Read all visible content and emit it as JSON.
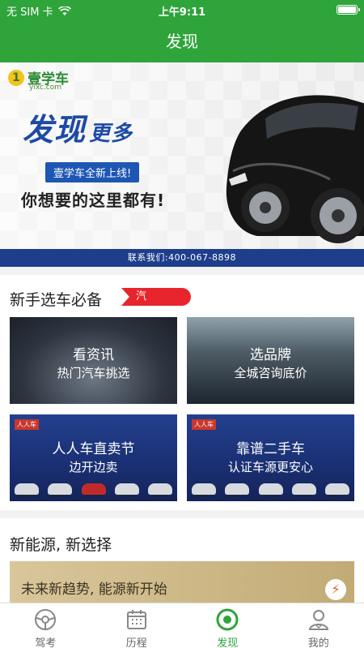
{
  "status_bar": {
    "carrier": "无 SIM 卡",
    "time": "上午9:11"
  },
  "header": {
    "title": "发现"
  },
  "banner": {
    "logo_name": "壹学车",
    "logo_url_text": "yixc.com",
    "headline_main": "发现",
    "headline_small": "更多",
    "pill_text": "壹学车全新上线!",
    "slogan": "你想要的这里都有!",
    "contact": "联系我们:400-067-8898"
  },
  "section_new_driver": {
    "title": "新手选车必备",
    "tag": "汽",
    "cards": [
      {
        "line1": "看资讯",
        "line2": "热门汽车挑选"
      },
      {
        "line1": "选品牌",
        "line2": "全城咨询底价"
      },
      {
        "line1": "人人车直卖节",
        "line2": "边开边卖",
        "logo": "人人车"
      },
      {
        "line1": "靠谱二手车",
        "line2": "认证车源更安心",
        "logo": "人人车"
      }
    ]
  },
  "section_new_energy": {
    "title": "新能源, 新选择",
    "card_text": "未来新趋势, 能源新开始"
  },
  "tabbar": {
    "items": [
      {
        "label": "驾考",
        "icon": "steering-wheel-icon"
      },
      {
        "label": "历程",
        "icon": "calendar-icon"
      },
      {
        "label": "发现",
        "icon": "discover-icon",
        "active": true
      },
      {
        "label": "我的",
        "icon": "person-icon"
      }
    ]
  },
  "colors": {
    "brand_green": "#2ea43a",
    "banner_blue": "#1e3e8c",
    "tag_red": "#e8252c"
  }
}
